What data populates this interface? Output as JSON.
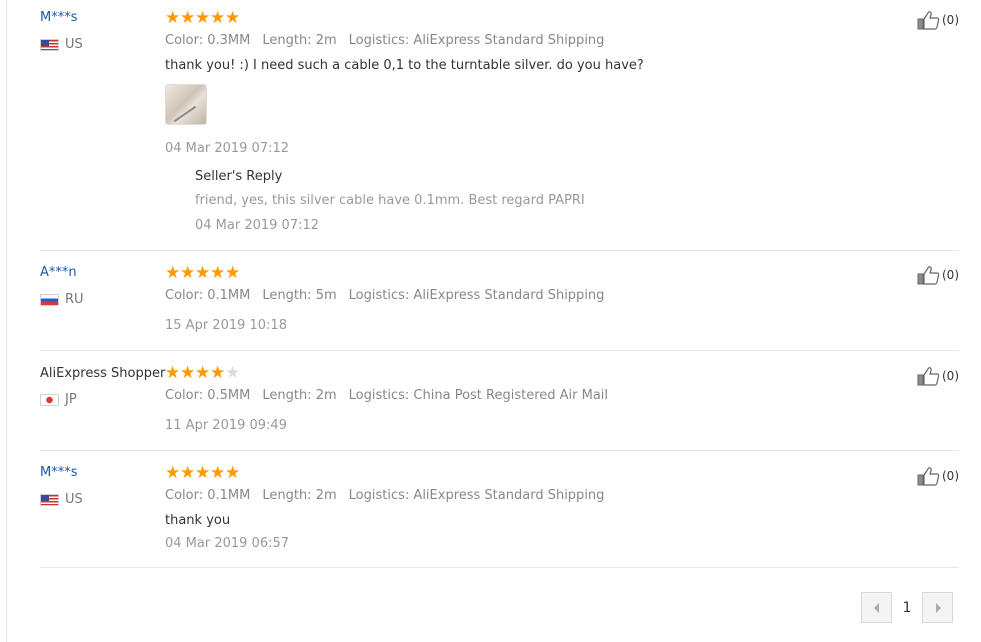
{
  "reviews": [
    {
      "user": "M***s",
      "country": "US",
      "rating": 5,
      "attributes": {
        "color_label": "Color:",
        "color": "0.3MM",
        "length_label": "Length:",
        "length": "2m",
        "logistics_label": "Logistics:",
        "logistics": "AliExpress Standard Shipping"
      },
      "feedback": "thank you! :) I need such a cable 0,1 to the turntable silver. do you have?",
      "date": "04 Mar 2019 07:12",
      "likes": "(0)",
      "seller_reply": {
        "title": "Seller's Reply",
        "text": "friend, yes, this silver cable have 0.1mm. Best regard PAPRI",
        "date": "04 Mar 2019 07:12"
      }
    },
    {
      "user": "A***n",
      "country": "RU",
      "rating": 5,
      "attributes": {
        "color_label": "Color:",
        "color": "0.1MM",
        "length_label": "Length:",
        "length": "5m",
        "logistics_label": "Logistics:",
        "logistics": "AliExpress Standard Shipping"
      },
      "date": "15 Apr 2019 10:18",
      "likes": "(0)"
    },
    {
      "user": "AliExpress Shopper",
      "country": "JP",
      "rating": 4,
      "attributes": {
        "color_label": "Color:",
        "color": "0.5MM",
        "length_label": "Length:",
        "length": "2m",
        "logistics_label": "Logistics:",
        "logistics": "China Post Registered Air Mail"
      },
      "date": "11 Apr 2019 09:49",
      "likes": "(0)"
    },
    {
      "user": "M***s",
      "country": "US",
      "rating": 5,
      "attributes": {
        "color_label": "Color:",
        "color": "0.1MM",
        "length_label": "Length:",
        "length": "2m",
        "logistics_label": "Logistics:",
        "logistics": "AliExpress Standard Shipping"
      },
      "feedback": "thank you",
      "date": "04 Mar 2019 06:57",
      "likes": "(0)"
    }
  ],
  "pagination": {
    "current_page": "1"
  },
  "colors": {
    "star": "#ff9900",
    "username": "#1a5aa8",
    "muted": "#999999"
  },
  "icons": {
    "like": "thumbs-up-icon",
    "prev": "chevron-left-icon",
    "next": "chevron-right-icon"
  }
}
